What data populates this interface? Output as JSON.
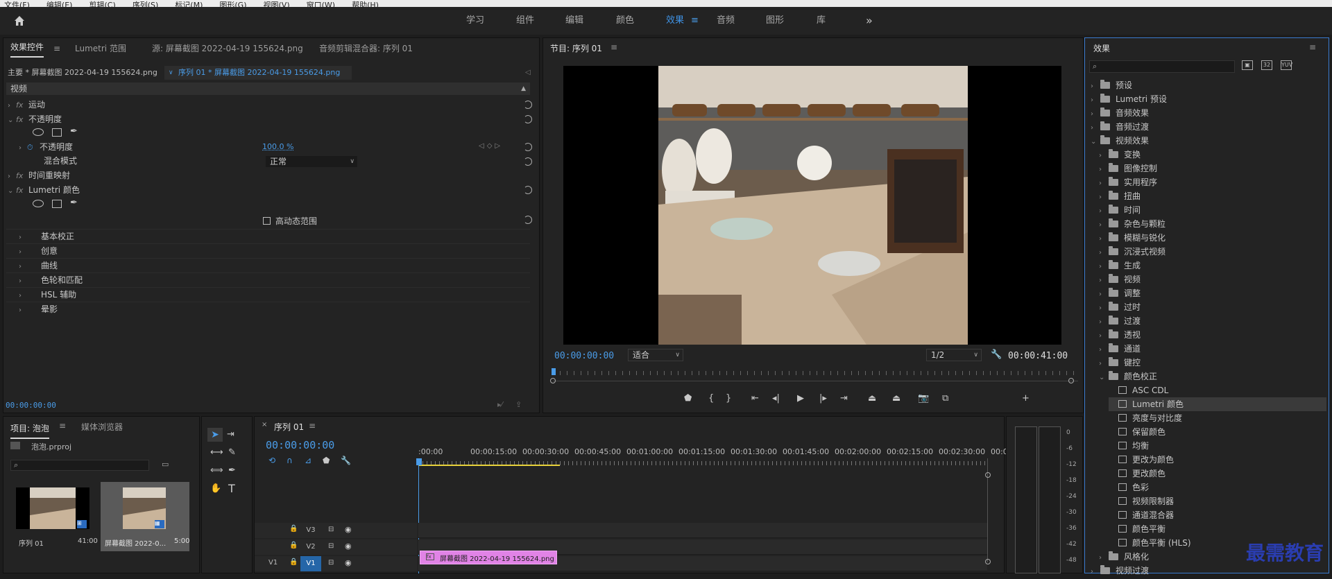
{
  "menu": [
    "文件(F)",
    "编辑(E)",
    "剪辑(C)",
    "序列(S)",
    "标记(M)",
    "图形(G)",
    "视图(V)",
    "窗口(W)",
    "帮助(H)"
  ],
  "workspaces": [
    {
      "label": "学习",
      "active": false
    },
    {
      "label": "组件",
      "active": false
    },
    {
      "label": "编辑",
      "active": false
    },
    {
      "label": "颜色",
      "active": false
    },
    {
      "label": "效果",
      "active": true
    },
    {
      "label": "音频",
      "active": false
    },
    {
      "label": "图形",
      "active": false
    },
    {
      "label": "库",
      "active": false
    }
  ],
  "effect_controls": {
    "tabs": [
      "效果控件",
      "Lumetri 范围",
      "源: 屏幕截图 2022-04-19 155624.png",
      "音频剪辑混合器: 序列 01"
    ],
    "master_label": "主要 * 屏幕截图 2022-04-19 155624.png",
    "seq_label": "序列 01 * 屏幕截图 2022-04-19 155624.png",
    "section": "视频",
    "motion": "运动",
    "opacity": "不透明度",
    "opacity_param": "不透明度",
    "opacity_value": "100.0 %",
    "blend_label": "混合模式",
    "blend_value": "正常",
    "time_remap": "时间重映射",
    "lumetri": "Lumetri 颜色",
    "hdr": "高动态范围",
    "lumetri_items": [
      "基本校正",
      "创意",
      "曲线",
      "色轮和匹配",
      "HSL 辅助",
      "晕影"
    ],
    "timecode": "00:00:00:00"
  },
  "program": {
    "title": "节目: 序列 01",
    "timecode": "00:00:00:00",
    "fit": "适合",
    "resolution": "1/2",
    "duration": "00:00:41:00"
  },
  "effects": {
    "title": "效果",
    "search_placeholder": "",
    "top": [
      "预设",
      "Lumetri 预设",
      "音频效果",
      "音频过渡",
      "视频效果"
    ],
    "video_effects": [
      "变换",
      "图像控制",
      "实用程序",
      "扭曲",
      "时间",
      "杂色与颗粒",
      "模糊与锐化",
      "沉浸式视频",
      "生成",
      "视频",
      "调整",
      "过时",
      "过渡",
      "透视",
      "通道",
      "键控",
      "颜色校正"
    ],
    "color_correction": [
      "ASC CDL",
      "Lumetri 颜色",
      "亮度与对比度",
      "保留颜色",
      "均衡",
      "更改为颜色",
      "更改颜色",
      "色彩",
      "视频限制器",
      "通道混合器",
      "颜色平衡",
      "颜色平衡 (HLS)"
    ],
    "after": [
      "风格化"
    ],
    "last": "视频过渡"
  },
  "project": {
    "tabs": [
      "项目: 泡泡",
      "媒体浏览器"
    ],
    "file": "泡泡.prproj",
    "items": [
      {
        "name": "序列 01",
        "dur": "41:00"
      },
      {
        "name": "屏幕截图 2022-0...",
        "dur": "5:00"
      }
    ]
  },
  "timeline": {
    "title": "序列 01",
    "timecode": "00:00:00:00",
    "ruler": [
      ":00:00",
      "00:00:15:00",
      "00:00:30:00",
      "00:00:45:00",
      "00:01:00:00",
      "00:01:15:00",
      "00:01:30:00",
      "00:01:45:00",
      "00:02:00:00",
      "00:02:15:00",
      "00:02:30:00",
      "00:0"
    ],
    "tracks": [
      "V3",
      "V2",
      "V1"
    ],
    "source_patch": "V1",
    "clip": "屏幕截图 2022-04-19 155624.png"
  },
  "meter_labels": [
    "0",
    "-6",
    "-12",
    "-18",
    "-24",
    "-30",
    "-36",
    "-42",
    "-48"
  ],
  "watermark": "最需教育"
}
